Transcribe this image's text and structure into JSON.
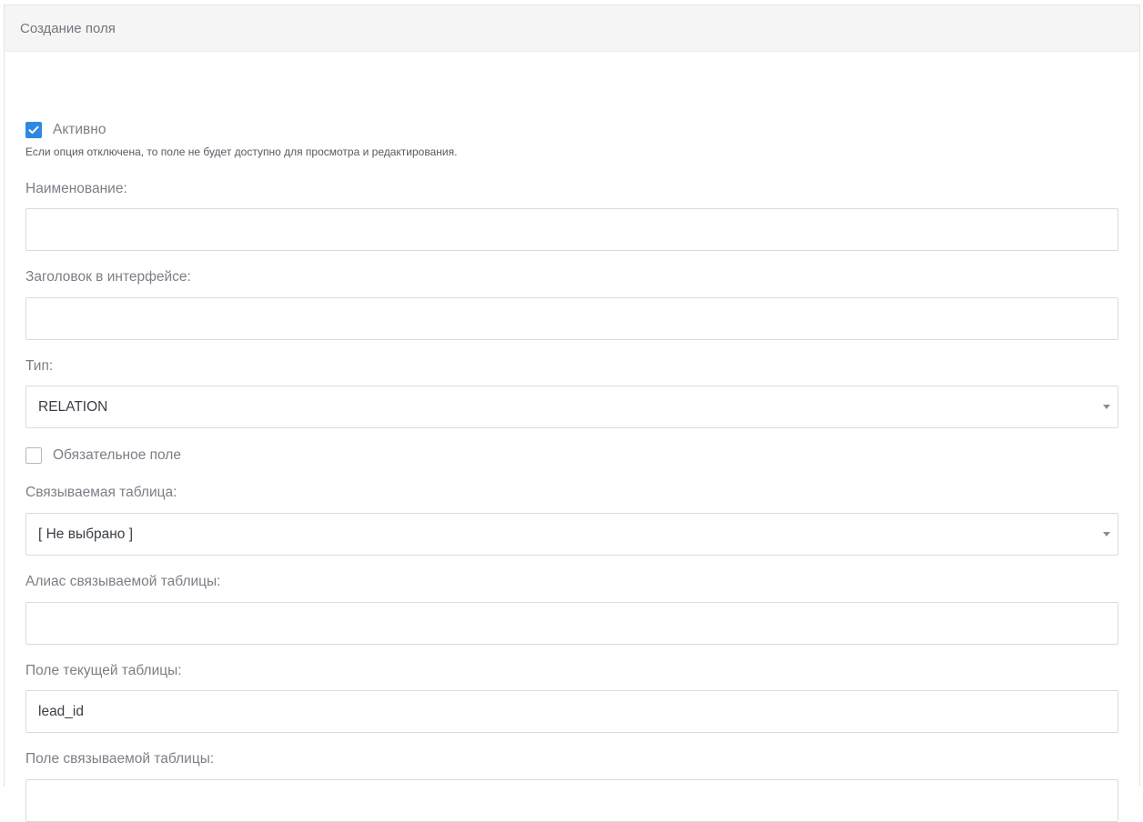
{
  "header": {
    "title": "Создание поля"
  },
  "active": {
    "label": "Активно",
    "checked": true,
    "hint": "Если опция отключена, то поле не будет доступно для просмотра и редактирования."
  },
  "fields": {
    "name": {
      "label": "Наименование:",
      "value": ""
    },
    "interface_title": {
      "label": "Заголовок в интерфейсе:",
      "value": ""
    },
    "type": {
      "label": "Тип:",
      "selected": "RELATION"
    },
    "required": {
      "label": "Обязательное поле",
      "checked": false
    },
    "linked_table": {
      "label": "Связываемая таблица:",
      "selected": "[ Не выбрано ]"
    },
    "linked_table_alias": {
      "label": "Алиас связываемой таблицы:",
      "value": ""
    },
    "current_table_field": {
      "label": "Поле текущей таблицы:",
      "value": "lead_id"
    },
    "linked_table_field": {
      "label": "Поле связываемой таблицы:",
      "value": ""
    }
  },
  "icons": {
    "checkmark": "check-icon",
    "dropdown": "chevron-down-icon"
  },
  "colors": {
    "accent": "#2d8ae0",
    "header_bg": "#f5f5f5",
    "border": "#d9dbde"
  }
}
